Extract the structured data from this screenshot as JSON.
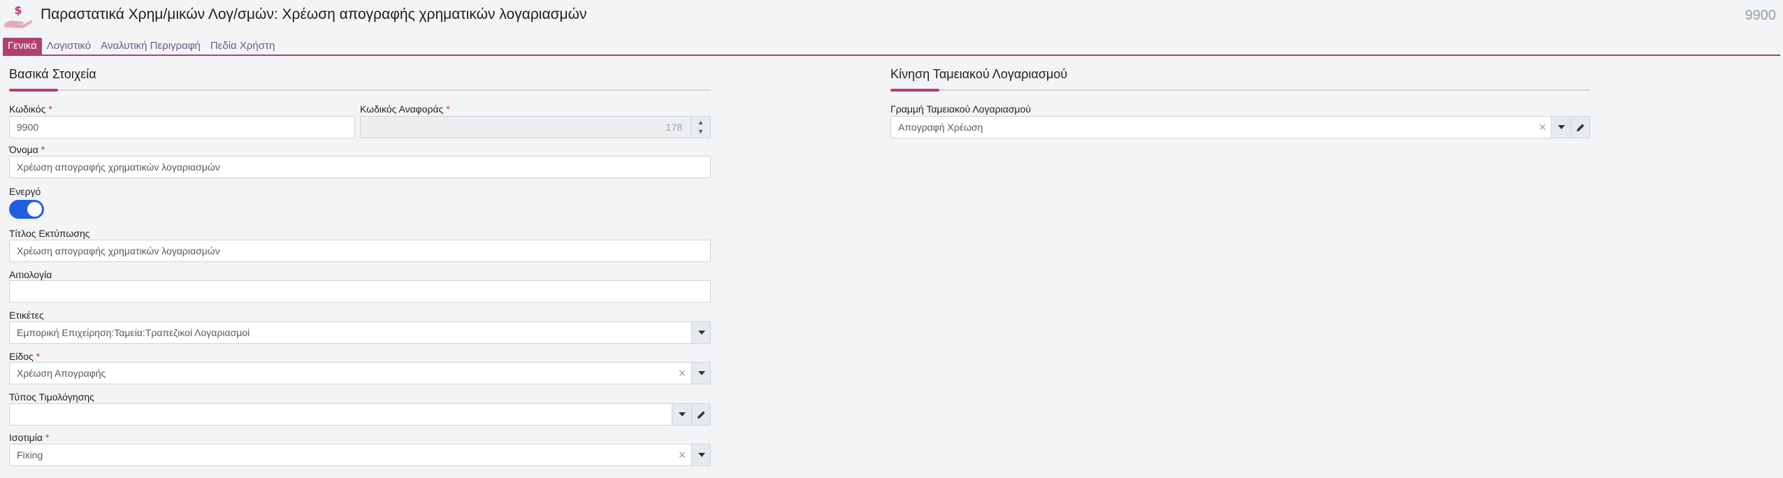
{
  "header": {
    "icon": "hand-dollar-icon",
    "title": "Παραστατικά Χρημ/μικών Λογ/σμών: Χρέωση απογραφής χρηματικών λογαριασμών",
    "record_number": "9900"
  },
  "tabs": [
    {
      "label": "Γενικά",
      "active": true
    },
    {
      "label": "Λογιστικό",
      "active": false
    },
    {
      "label": "Αναλυτική Περιγραφή",
      "active": false
    },
    {
      "label": "Πεδία Χρήστη",
      "active": false
    }
  ],
  "basic": {
    "section_title": "Βασικά Στοιχεία",
    "code_label": "Κωδικός",
    "code_value": "9900",
    "ref_code_label": "Κωδικός Αναφοράς",
    "ref_code_value": "178",
    "name_label": "Όνομα",
    "name_value": "Χρέωση απογραφής χρηματικών λογαριασμών",
    "active_label": "Ενεργό",
    "active_value": true,
    "print_title_label": "Τίτλος Εκτύπωσης",
    "print_title_value": "Χρέωση απογραφής χρηματικών λογαριασμών",
    "reason_label": "Αιτιολογία",
    "reason_value": "",
    "tags_label": "Ετικέτες",
    "tags_value": "Εμπορική Επιχείρηση:Ταμεία:Τραπεζικοί Λογαριασμοί",
    "type_label": "Είδος",
    "type_value": "Χρέωση Απογραφής",
    "invoicing_type_label": "Τύπος Τιμολόγησης",
    "invoicing_type_value": "",
    "parity_label": "Ισοτιμία",
    "parity_value": "Fixing",
    "required_mark": "*"
  },
  "cash": {
    "section_title": "Κίνηση Ταμειακού Λογαριασμού",
    "line_label": "Γραμμή Ταμειακού Λογαριασμού",
    "line_value": "Απογραφή Χρέωση"
  },
  "colors": {
    "accent": "#b2406f",
    "toggle_on": "#1f5fe0",
    "background": "#f3f4f5"
  }
}
